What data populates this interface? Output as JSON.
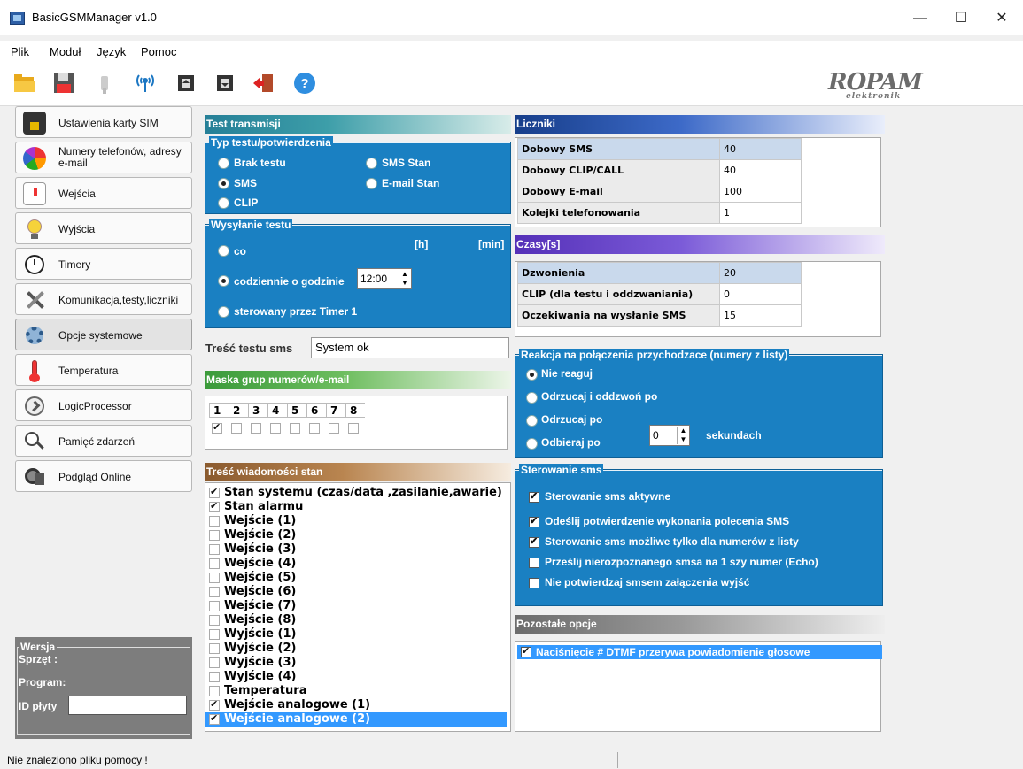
{
  "window": {
    "title": "BasicGSMManager v1.0",
    "minimize": "—",
    "maximize": "☐",
    "close": "✕"
  },
  "menu": [
    "Plik",
    "Moduł",
    "Język",
    "Pomoc"
  ],
  "logo": {
    "text": "ROPAM",
    "sub": "elektronik"
  },
  "sidebar": {
    "items": [
      {
        "label": "Ustawienia karty SIM",
        "icon": "sim-card-icon"
      },
      {
        "label": "Numery telefonów, adresy e-mail",
        "icon": "color-wheel-icon"
      },
      {
        "label": "Wejścia",
        "icon": "input-icon"
      },
      {
        "label": "Wyjścia",
        "icon": "lightbulb-icon"
      },
      {
        "label": "Timery",
        "icon": "clock-icon"
      },
      {
        "label": "Komunikacja,testy,liczniki",
        "icon": "tools-icon"
      },
      {
        "label": "Opcje systemowe",
        "icon": "gear-icon"
      },
      {
        "label": "Temperatura",
        "icon": "thermometer-icon"
      },
      {
        "label": "LogicProcessor",
        "icon": "logic-icon"
      },
      {
        "label": "Pamięć zdarzeń",
        "icon": "memory-search-icon"
      },
      {
        "label": "Podgląd Online",
        "icon": "online-view-icon"
      }
    ],
    "version": {
      "legend": "Wersja",
      "hardware": "Sprzęt :",
      "program": "Program:",
      "board_id": "ID płyty",
      "board_id_value": ""
    }
  },
  "test": {
    "header": "Test transmisji",
    "type_legend": "Typ testu/potwierdzenia",
    "types": {
      "none": "Brak testu",
      "sms": "SMS",
      "clip": "CLIP",
      "sms_state": "SMS Stan",
      "email_state": "E-mail Stan"
    },
    "send_legend": "Wysyłanie testu",
    "send_every": "co",
    "unit_h": "[h]",
    "unit_min": "[min]",
    "send_daily": "codziennie o godzinie",
    "daily_time": "12:00",
    "send_timer": "sterowany przez Timer 1",
    "sms_text_label": "Treść testu sms",
    "sms_text_value": "System ok"
  },
  "mask": {
    "header": "Maska grup numerów/e-mail",
    "groups": [
      "1",
      "2",
      "3",
      "4",
      "5",
      "6",
      "7",
      "8"
    ],
    "checked": [
      true,
      false,
      false,
      false,
      false,
      false,
      false,
      false
    ]
  },
  "state_msg": {
    "header": "Treść wiadomości stan",
    "items": [
      {
        "label": "Stan systemu (czas/data ,zasilanie,awarie)",
        "checked": true
      },
      {
        "label": "Stan alarmu",
        "checked": true
      },
      {
        "label": "Wejście (1)",
        "checked": false
      },
      {
        "label": "Wejście (2)",
        "checked": false
      },
      {
        "label": "Wejście (3)",
        "checked": false
      },
      {
        "label": "Wejście (4)",
        "checked": false
      },
      {
        "label": "Wejście (5)",
        "checked": false
      },
      {
        "label": "Wejście (6)",
        "checked": false
      },
      {
        "label": "Wejście (7)",
        "checked": false
      },
      {
        "label": "Wejście (8)",
        "checked": false
      },
      {
        "label": "Wyjście (1)",
        "checked": false
      },
      {
        "label": "Wyjście (2)",
        "checked": false
      },
      {
        "label": "Wyjście (3)",
        "checked": false
      },
      {
        "label": "Wyjście (4)",
        "checked": false
      },
      {
        "label": "Temperatura",
        "checked": false
      },
      {
        "label": "Wejście analogowe (1)",
        "checked": true
      },
      {
        "label": "Wejście analogowe (2)",
        "checked": true
      }
    ]
  },
  "counters": {
    "header": "Liczniki",
    "rows": [
      {
        "label": "Dobowy SMS",
        "value": "40"
      },
      {
        "label": "Dobowy CLIP/CALL",
        "value": "40"
      },
      {
        "label": "Dobowy E-mail",
        "value": "100"
      },
      {
        "label": "Kolejki telefonowania",
        "value": "1"
      }
    ]
  },
  "times": {
    "header": "Czasy[s]",
    "rows": [
      {
        "label": "Dzwonienia",
        "value": "20"
      },
      {
        "label": "CLIP (dla testu i oddzwaniania)",
        "value": "0"
      },
      {
        "label": "Oczekiwania na wysłanie SMS",
        "value": "15"
      }
    ]
  },
  "reaction": {
    "legend": "Reakcja na połączenia przychodzace (numery z listy)",
    "opt_ignore": "Nie reaguj",
    "opt_reject_callback": "Odrzucaj i oddzwoń po",
    "opt_reject": "Odrzucaj po",
    "opt_answer": "Odbieraj po",
    "seconds_value": "0",
    "seconds_label": "sekundach"
  },
  "sms_control": {
    "legend": "Sterowanie sms",
    "items": [
      {
        "label": "Sterowanie sms aktywne",
        "checked": true
      },
      {
        "label": "Odeślij potwierdzenie wykonania polecenia SMS",
        "checked": true
      },
      {
        "label": "Sterowanie sms możliwe tylko dla numerów z listy",
        "checked": true
      },
      {
        "label": "Prześlij nierozpoznanego smsa na 1 szy numer (Echo)",
        "checked": false
      },
      {
        "label": "Nie potwierdzaj smsem załączenia wyjść",
        "checked": false
      }
    ]
  },
  "other": {
    "header": "Pozostałe opcje",
    "item": "Naciśnięcie # DTMF  przerywa powiadomienie głosowe",
    "checked": true
  },
  "status": {
    "text": "Nie znaleziono pliku pomocy !"
  },
  "colors": {
    "panel_blue": "#1a80c2",
    "selection": "#3399ff"
  }
}
